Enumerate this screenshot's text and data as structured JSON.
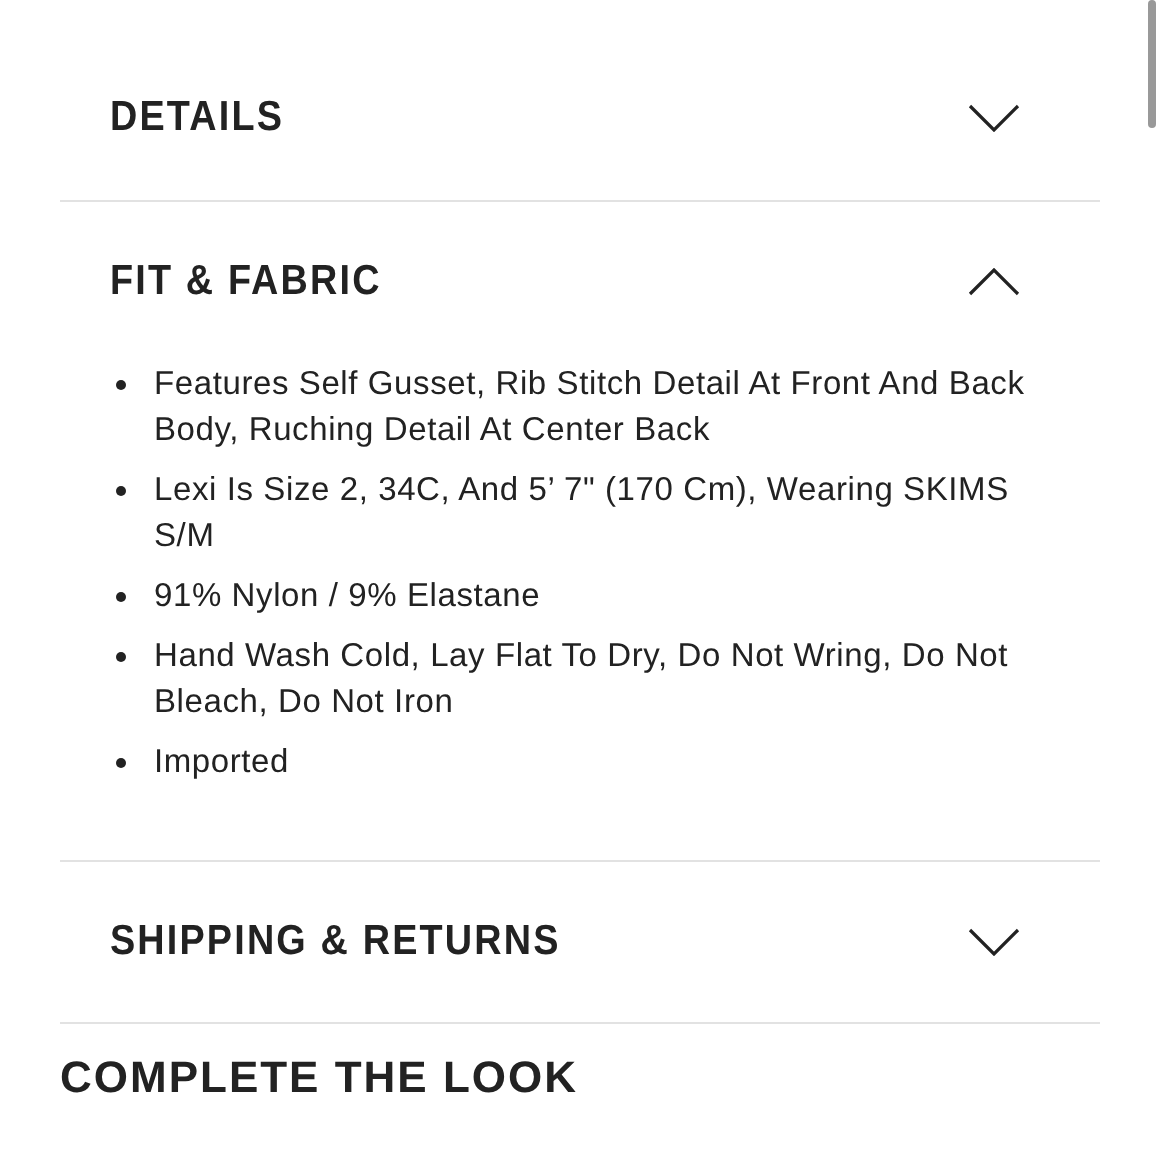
{
  "sections": [
    {
      "title": "DETAILS",
      "expanded": false
    },
    {
      "title": "FIT & FABRIC",
      "expanded": true,
      "items": [
        "Features Self Gusset, Rib Stitch Detail At Front And Back Body, Ruching Detail At Center Back",
        "Lexi Is Size 2, 34C, And 5’ 7\" (170 Cm), Wearing SKIMS S/M",
        "91% Nylon / 9% Elastane",
        "Hand Wash Cold, Lay Flat To Dry, Do Not Wring, Do Not Bleach, Do Not Iron",
        "Imported"
      ]
    },
    {
      "title": "SHIPPING & RETURNS",
      "expanded": false
    }
  ],
  "next_heading": "COMPLETE THE LOOK"
}
